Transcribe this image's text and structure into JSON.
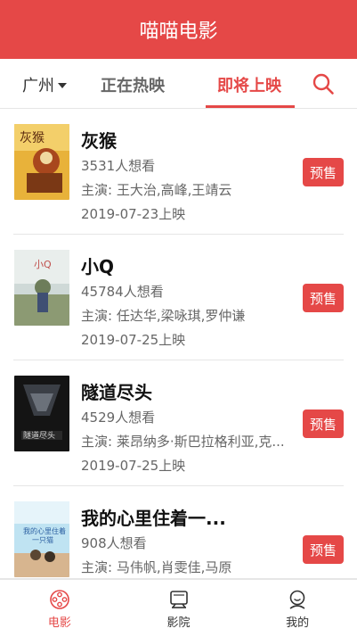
{
  "header": {
    "title": "喵喵电影"
  },
  "nav": {
    "city": "广州",
    "tab_now": "正在热映",
    "tab_coming": "即将上映"
  },
  "colors": {
    "accent": "#e54847"
  },
  "movies": [
    {
      "title": "灰猴",
      "wish": "3531人想看",
      "actors": "主演: 王大治,高峰,王靖云",
      "date": "2019-07-23上映",
      "button": "预售"
    },
    {
      "title": "小Q",
      "wish": "45784人想看",
      "actors": "主演: 任达华,梁咏琪,罗仲谦",
      "date": "2019-07-25上映",
      "button": "预售"
    },
    {
      "title": "隧道尽头",
      "wish": "4529人想看",
      "actors": "主演: 莱昂纳多·斯巴拉格利亚,克...",
      "date": "2019-07-25上映",
      "button": "预售"
    },
    {
      "title": "我的心里住着一...",
      "wish": "908人想看",
      "actors": "主演: 马伟帆,肖雯佳,马原",
      "date": "",
      "button": "预售"
    }
  ],
  "tabbar": {
    "movie": {
      "label": "电影",
      "icon": "film-reel-icon"
    },
    "cinema": {
      "label": "影院",
      "icon": "cinema-icon"
    },
    "mine": {
      "label": "我的",
      "icon": "user-icon"
    }
  }
}
